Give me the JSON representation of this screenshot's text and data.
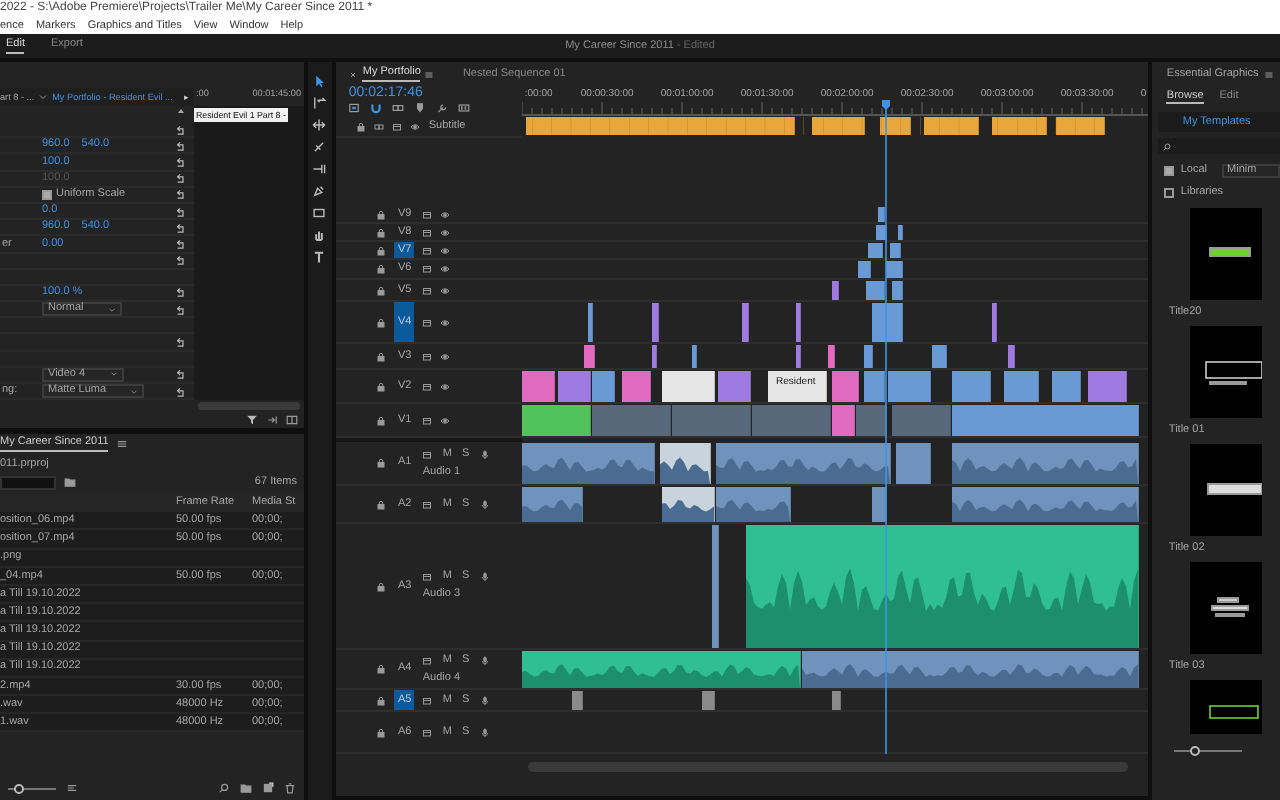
{
  "window": {
    "title": "2022 - S:\\Adobe Premiere\\Projects\\Trailer Me\\My Career Since 2011 *"
  },
  "menu": [
    "ence",
    "Markers",
    "Graphics and Titles",
    "View",
    "Window",
    "Help"
  ],
  "workspaces": [
    {
      "label": "Edit",
      "selected": true
    },
    {
      "label": "Export",
      "selected": false
    }
  ],
  "document": {
    "title": "My Career Since 2011",
    "state": "- Edited"
  },
  "effect_controls": {
    "source": "art 8 - ...",
    "sequence": "My Portfolio - Resident Evil ...",
    "expand": "▸",
    "ruler": [
      ":00",
      "00:01:45:00"
    ],
    "clip": "Resident Evil 1 Part 8 - ",
    "rows": [
      {
        "kind": "blank",
        "reset": true
      },
      {
        "kind": "values",
        "values": [
          "960.0",
          "540.0"
        ],
        "reset": true
      },
      {
        "kind": "values",
        "values": [
          "100.0"
        ],
        "reset": true
      },
      {
        "kind": "values",
        "values": [
          "100.0"
        ],
        "disabled": true,
        "reset": true
      },
      {
        "kind": "checkbox",
        "text": "Uniform Scale",
        "checked": true,
        "reset": true
      },
      {
        "kind": "values",
        "values": [
          "0.0"
        ],
        "reset": true
      },
      {
        "kind": "values",
        "values": [
          "960.0",
          "540.0"
        ],
        "reset": true
      },
      {
        "kind": "values",
        "label": "er",
        "values": [
          "0.00"
        ],
        "reset": true
      },
      {
        "kind": "blank",
        "reset": true
      },
      {
        "kind": "blank",
        "reset": false
      },
      {
        "kind": "values",
        "values": [
          "100.0 %"
        ],
        "reset": true
      },
      {
        "kind": "dropdown",
        "value": "Normal",
        "reset": true
      },
      {
        "kind": "blank",
        "reset": false
      },
      {
        "kind": "blank",
        "reset": true
      },
      {
        "kind": "blank",
        "reset": false
      },
      {
        "kind": "dropdown",
        "value": "Video 4",
        "reset": true
      },
      {
        "kind": "dropdown",
        "label": "ng:",
        "value": "Matte Luma",
        "reset": true
      }
    ]
  },
  "project": {
    "tab": "My Career Since 2011",
    "file": "011.prproj",
    "count": "67 Items",
    "columns": [
      "Frame Rate",
      "Media St"
    ],
    "zoom_slider": {
      "level": 0.15
    },
    "rows": [
      {
        "name": "osition_06.mp4",
        "frame_rate": "50.00 fps",
        "media_start": "00;00;"
      },
      {
        "name": "osition_07.mp4",
        "frame_rate": "50.00 fps",
        "media_start": "00;00;"
      },
      {
        "name": ".png"
      },
      {
        "name": "_04.mp4",
        "frame_rate": "50.00 fps",
        "media_start": "00;00;"
      },
      {
        "name": "a Till 19.10.2022"
      },
      {
        "name": "a Till 19.10.2022"
      },
      {
        "name": "a Till 19.10.2022"
      },
      {
        "name": "a Till 19.10.2022"
      },
      {
        "name": "a Till 19.10.2022"
      },
      {
        "name": "2.mp4",
        "frame_rate": "30.00 fps",
        "media_start": "00;00;"
      },
      {
        "name": ".wav",
        "frame_rate": "48000 Hz",
        "media_start": "00;00;"
      },
      {
        "name": "1.wav",
        "frame_rate": "48000 Hz",
        "media_start": "00;00;"
      }
    ]
  },
  "timeline": {
    "tabs": [
      {
        "label": "My Portfolio",
        "selected": true
      },
      {
        "label": "Nested Sequence 01",
        "selected": false
      }
    ],
    "timecode": "00:02:17:46",
    "ruler": [
      ":00:00",
      "00:00:30:00",
      "00:01:00:00",
      "00:01:30:00",
      "00:02:00:00",
      "00:02:30:00",
      "00:03:00:00",
      "00:03:30:00",
      "0"
    ],
    "subtitle_track": "Subtitle",
    "video_tracks": [
      {
        "label": "V9",
        "targeted": false
      },
      {
        "label": "V8",
        "targeted": false
      },
      {
        "label": "V7",
        "targeted": true
      },
      {
        "label": "V6",
        "targeted": false
      },
      {
        "label": "V5",
        "targeted": false
      },
      {
        "label": "V4",
        "targeted": true
      },
      {
        "label": "V3",
        "targeted": false
      },
      {
        "label": "V2",
        "targeted": false
      },
      {
        "label": "V1",
        "targeted": false
      }
    ],
    "audio_tracks": [
      {
        "label": "A1",
        "name": "Audio 1",
        "mute": "M",
        "solo": "S",
        "targeted": false
      },
      {
        "label": "A2",
        "mute": "M",
        "solo": "S",
        "targeted": false
      },
      {
        "label": "A3",
        "name": "Audio 3",
        "mute": "M",
        "solo": "S",
        "targeted": false
      },
      {
        "label": "A4",
        "name": "Audio 4",
        "mute": "M",
        "solo": "S",
        "targeted": false
      },
      {
        "label": "A5",
        "mute": "M",
        "solo": "S",
        "targeted": true
      },
      {
        "label": "A6",
        "mute": "M",
        "solo": "S",
        "targeted": false
      }
    ],
    "clip_label": "Resident"
  },
  "essential_graphics": {
    "title": "Essential Graphics",
    "tabs": [
      {
        "label": "Browse",
        "selected": true
      },
      {
        "label": "Edit",
        "selected": false
      }
    ],
    "library": "My Templates",
    "sort": "Minim",
    "filters": [
      {
        "label": "Local",
        "checked": true
      },
      {
        "label": "Libraries",
        "checked": false
      }
    ],
    "thumbnail_slider": {
      "level": 0.25
    },
    "templates": [
      {
        "title": "Title20",
        "thumbnail": true
      },
      {
        "title": "Title 01",
        "thumbnail": true
      },
      {
        "title": "Title 02",
        "thumbnail": true
      },
      {
        "title": "Title 03",
        "thumbnail": true
      },
      {
        "thumbnail": true
      }
    ]
  }
}
